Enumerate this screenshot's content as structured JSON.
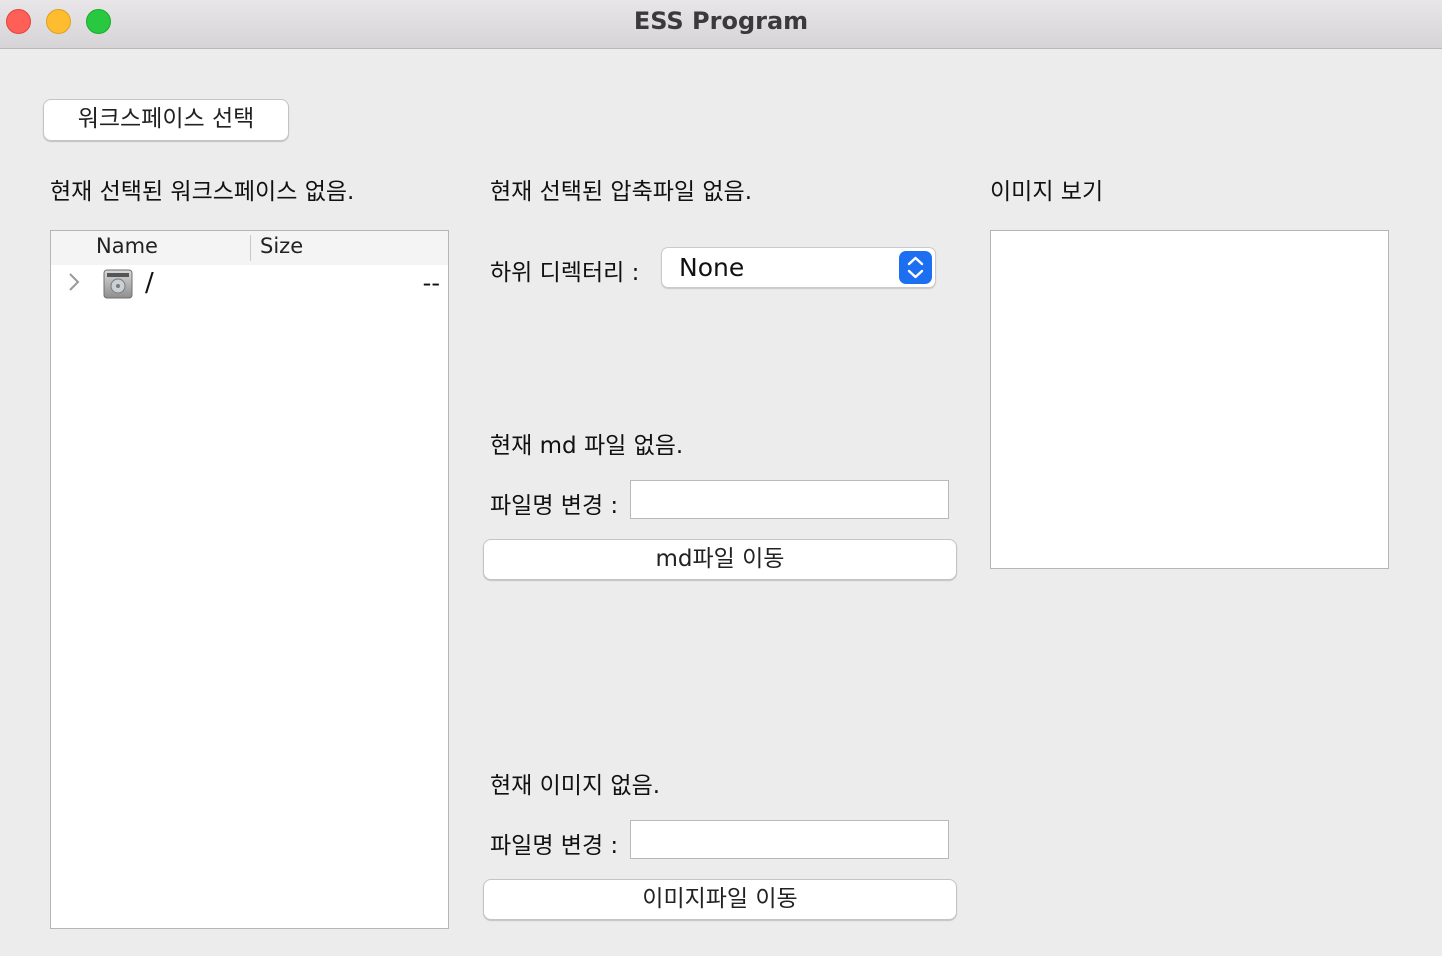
{
  "window": {
    "title": "ESS Program"
  },
  "workspace": {
    "select_button": "워크스페이스 선택",
    "status": "현재 선택된 워크스페이스 없음."
  },
  "tree": {
    "columns": [
      "Name",
      "Size"
    ],
    "rows": [
      {
        "name": "/",
        "size": "--",
        "icon": "hard-drive-icon"
      }
    ]
  },
  "archive": {
    "status": "현재 선택된 압축파일 없음.",
    "subdir_label": "하위 디렉터리 :",
    "subdir_value": "None"
  },
  "md": {
    "status": "현재 md 파일 없음.",
    "rename_label": "파일명 변경 :",
    "rename_value": "",
    "move_button": "md파일 이동"
  },
  "image": {
    "status": "현재 이미지 없음.",
    "rename_label": "파일명 변경 :",
    "rename_value": "",
    "move_button": "이미지파일 이동",
    "preview_label": "이미지 보기"
  }
}
